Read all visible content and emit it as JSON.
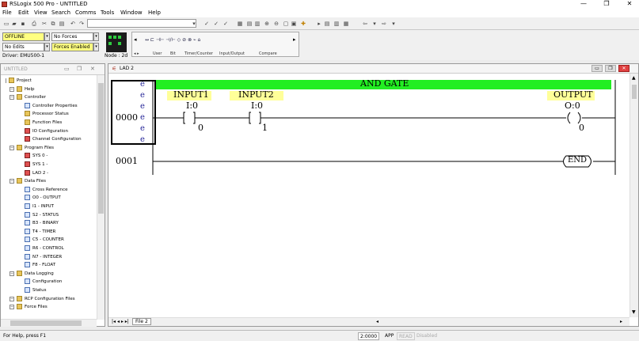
{
  "window": {
    "title": "RSLogix 500 Pro - UNTITLED"
  },
  "menu": [
    "File",
    "Edit",
    "View",
    "Search",
    "Comms",
    "Tools",
    "Window",
    "Help"
  ],
  "status_panel": {
    "mode": "OFFLINE",
    "forces": "No Forces",
    "edits": "No Edits",
    "forces_enabled": "Forces Enabled",
    "driver": "Driver: EMU500-1",
    "node": "Node : 2d"
  },
  "instruction_tabs": [
    "User",
    "Bit",
    "Timer/Counter",
    "Input/Output",
    "Compare"
  ],
  "project_panel": {
    "title": "UNTITLED",
    "tree": [
      {
        "label": "Project",
        "icon": "folder-icon",
        "depth": 0
      },
      {
        "label": "Help",
        "icon": "folder-icon",
        "depth": 1
      },
      {
        "label": "Controller",
        "icon": "folder-icon",
        "depth": 1
      },
      {
        "label": "Controller Properties",
        "icon": "controller-icon",
        "depth": 2
      },
      {
        "label": "Processor Status",
        "icon": "processor-icon",
        "depth": 2
      },
      {
        "label": "Function Files",
        "icon": "function-icon",
        "depth": 2
      },
      {
        "label": "IO Configuration",
        "icon": "io-icon",
        "depth": 2
      },
      {
        "label": "Channel Configuration",
        "icon": "channel-icon",
        "depth": 2
      },
      {
        "label": "Program Files",
        "icon": "folder-icon",
        "depth": 1
      },
      {
        "label": "SYS 0 -",
        "icon": "program-file-icon",
        "depth": 2
      },
      {
        "label": "SYS 1 -",
        "icon": "program-file-icon",
        "depth": 2
      },
      {
        "label": "LAD 2 -",
        "icon": "ladder-file-icon",
        "depth": 2
      },
      {
        "label": "Data Files",
        "icon": "folder-icon",
        "depth": 1
      },
      {
        "label": "Cross Reference",
        "icon": "data-file-icon",
        "depth": 2
      },
      {
        "label": "O0 - OUTPUT",
        "icon": "data-file-icon",
        "depth": 2
      },
      {
        "label": "I1 - INPUT",
        "icon": "data-file-icon",
        "depth": 2
      },
      {
        "label": "S2 - STATUS",
        "icon": "data-file-icon",
        "depth": 2
      },
      {
        "label": "B3 - BINARY",
        "icon": "data-file-icon",
        "depth": 2
      },
      {
        "label": "T4 - TIMER",
        "icon": "data-file-icon",
        "depth": 2
      },
      {
        "label": "C5 - COUNTER",
        "icon": "data-file-icon",
        "depth": 2
      },
      {
        "label": "R6 - CONTROL",
        "icon": "data-file-icon",
        "depth": 2
      },
      {
        "label": "N7 - INTEGER",
        "icon": "data-file-icon",
        "depth": 2
      },
      {
        "label": "F8 - FLOAT",
        "icon": "data-file-icon",
        "depth": 2
      },
      {
        "label": "Data Logging",
        "icon": "folder-icon",
        "depth": 1
      },
      {
        "label": "Configuration",
        "icon": "data-file-icon",
        "depth": 2
      },
      {
        "label": "Status",
        "icon": "data-file-icon",
        "depth": 2
      },
      {
        "label": "RCP Configuration Files",
        "icon": "folder-icon",
        "depth": 1
      },
      {
        "label": "Force Files",
        "icon": "folder-icon",
        "depth": 1
      }
    ]
  },
  "ladder_window": {
    "title": "LAD 2",
    "tab": "File 2",
    "rung0": {
      "number": "0000",
      "comment": "AND GATE",
      "e_marks": [
        "e",
        "e",
        "e",
        "e",
        "e",
        "e"
      ],
      "input1": {
        "symbol": "INPUT1",
        "address": "I:0",
        "bit": "0"
      },
      "input2": {
        "symbol": "INPUT2",
        "address": "I:0",
        "bit": "1"
      },
      "output": {
        "symbol": "OUTPUT",
        "address": "O:0",
        "bit": "0"
      }
    },
    "rung1": {
      "number": "0001",
      "end_label": "END"
    }
  },
  "statusbar": {
    "help": "For Help, press F1",
    "position": "2:0000",
    "app": "APP",
    "read": "READ",
    "state": "Disabled"
  },
  "colors": {
    "rung_comment_bg": "#22ee22",
    "address_bg": "#ffff99",
    "mode_field": "#ffff80"
  }
}
